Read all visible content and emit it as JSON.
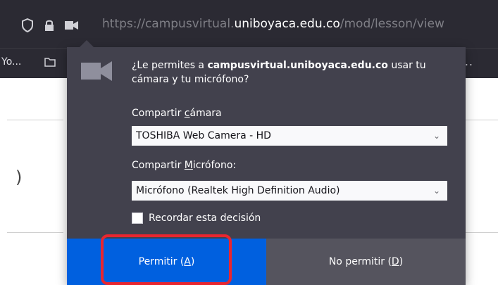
{
  "browser": {
    "url_prefix": "https://",
    "url_sub": "campusvirtual.",
    "url_host": "uniboyaca.edu.co",
    "url_path": "/mod/lesson/view",
    "bookmark_label": "Yo...",
    "overflow_label": "..."
  },
  "permission": {
    "prompt_prefix": "¿Le permites a ",
    "prompt_site": "campusvirtual.uniboyaca.edu.co",
    "prompt_suffix": " usar tu cámara y tu micrófono?",
    "camera_label_pre": "Compartir ",
    "camera_label_key": "c",
    "camera_label_post": "ámara",
    "camera_value": "TOSHIBA Web Camera - HD",
    "mic_label_pre": "Compartir ",
    "mic_label_key": "M",
    "mic_label_post": "icrófono:",
    "mic_value": "Micrófono (Realtek High Definition Audio)",
    "remember_label": "Recordar esta decisión",
    "allow_label_pre": "Permitir (",
    "allow_label_key": "A",
    "allow_label_post": ")",
    "deny_label_pre": "No permitir (",
    "deny_label_key": "D",
    "deny_label_post": ")"
  },
  "page": {
    "glyph": ")"
  },
  "colors": {
    "allow": "#0060df",
    "highlight": "#e8262f"
  },
  "icons": [
    "shield-icon",
    "lock-icon",
    "camera-icon",
    "folder-icon",
    "chevron-down-icon"
  ]
}
